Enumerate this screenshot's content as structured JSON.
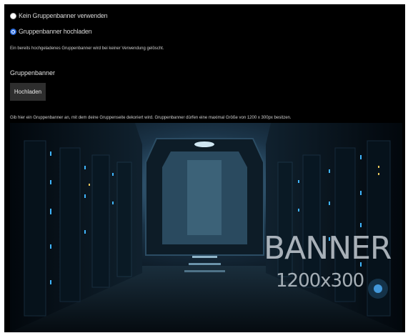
{
  "banner_options": {
    "no_banner_label": "Kein Gruppenbanner verwenden",
    "upload_banner_label": "Gruppenbanner hochladen",
    "selected": "upload"
  },
  "delete_note": "Ein bereits hochgeladenes Gruppenbanner wird bei keiner Verwendung gelöscht.",
  "section": {
    "title": "Gruppenbanner",
    "upload_button": "Hochladen",
    "hint": "Gib hier ein Gruppenbanner an, mit dem deine Gruppenseite dekoriert wird. Gruppenbanner dürfen eine maximal Größe von 1200 x 300px besitzen."
  },
  "banner_preview": {
    "title": "BANNER",
    "dimensions": "1200x300"
  },
  "colors": {
    "background": "#000000",
    "radio_accent": "#2f6fe0",
    "button_bg": "#2e2e2e"
  }
}
